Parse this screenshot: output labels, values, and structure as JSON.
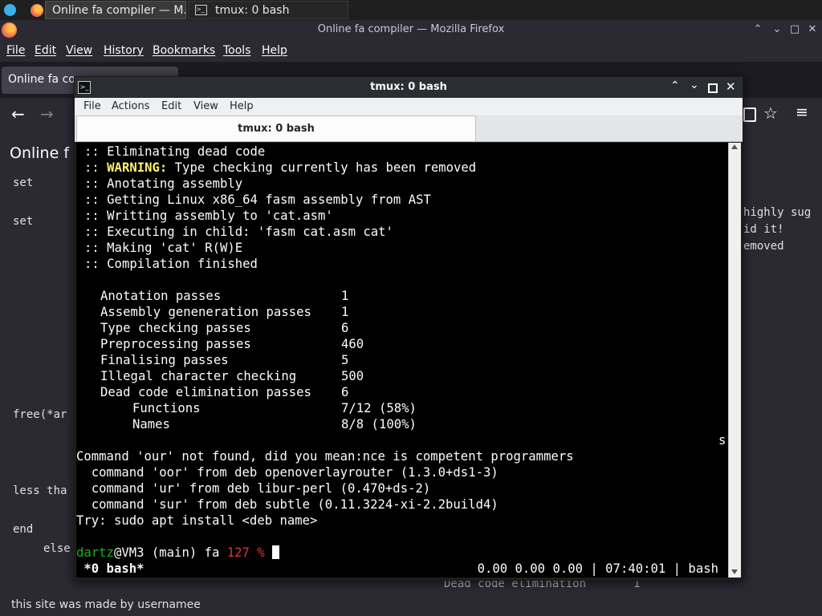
{
  "taskbar": {
    "tasks": [
      {
        "label": "Online fa compiler — M..."
      },
      {
        "label": "tmux: 0 bash"
      }
    ]
  },
  "firefox": {
    "title": "Online fa compiler — Mozilla Firefox",
    "menu": [
      "File",
      "Edit",
      "View",
      "History",
      "Bookmarks",
      "Tools",
      "Help"
    ],
    "tab_title": "Online fa co",
    "page": {
      "heading": "Online f",
      "code_lines": [
        "set",
        "set",
        "free(*ar",
        "less tha",
        "end",
        "else"
      ],
      "right_lines": [
        "highly sug",
        "id it!",
        "emoved"
      ],
      "right_s": "s",
      "bottom_note": "this site was made by usernamee",
      "bottom_right": "Dead code elimination       1"
    }
  },
  "konsole": {
    "title": "tmux: 0 bash",
    "menu": [
      "File",
      "Actions",
      "Edit",
      "View",
      "Help"
    ],
    "tab_label": "tmux: 0 bash",
    "terminal": {
      "line1": ":: Eliminating dead code",
      "warn_prefix": ":: ",
      "warn_label": "WARNING:",
      "warn_text": " Type checking currently has been removed",
      "line3": ":: Anotating assembly",
      "line4": ":: Getting Linux x86_64 fasm assembly from AST",
      "line5": ":: Writting assembly to 'cat.asm'",
      "line6": ":: Executing in child: 'fasm cat.asm cat'",
      "line7": ":: Making 'cat' R(W)E",
      "line8": ":: Compilation finished",
      "stats": [
        {
          "label": "Anotation passes",
          "value": "1"
        },
        {
          "label": "Assembly geneneration passes",
          "value": "1"
        },
        {
          "label": "Type checking passes",
          "value": "6"
        },
        {
          "label": "Preprocessing passes",
          "value": "460"
        },
        {
          "label": "Finalising passes",
          "value": "5"
        },
        {
          "label": "Illegal character checking",
          "value": "500"
        },
        {
          "label": "Dead code elimination passes",
          "value": "6"
        }
      ],
      "substats": [
        {
          "label": "Functions",
          "value": "7/12 (58%)"
        },
        {
          "label": "Names",
          "value": "8/8 (100%)"
        }
      ],
      "trailing_s": "s",
      "cmd_not_found": "Command 'our' not found, did you mean:nce is competent programmers",
      "suggest1": "  command 'oor' from deb openoverlayrouter (1.3.0+ds1-3)",
      "suggest2": "  command 'ur' from deb libur-perl (0.470+ds-2)",
      "suggest3": "  command 'sur' from deb subtle (0.11.3224-xi-2.2build4)",
      "try_line": "Try: sudo apt install <deb name>",
      "prompt_user": "dartz",
      "prompt_host": "@VM3 (main) fa ",
      "prompt_code": "127 % ",
      "status_left": " *0 bash*",
      "status_right": "0.00 0.00 0.00 | 07:40:01 | bash"
    }
  }
}
